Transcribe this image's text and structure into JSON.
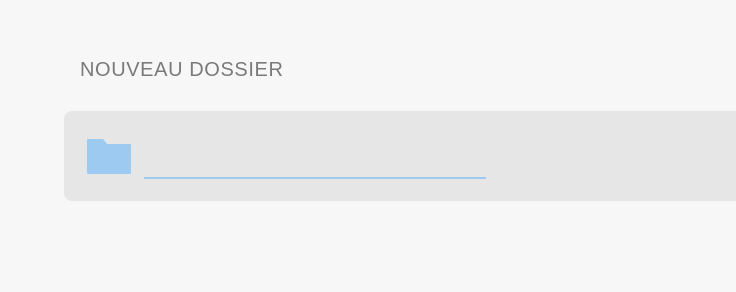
{
  "dialog": {
    "title": "NOUVEAU DOSSIER",
    "folder_icon": "folder-icon",
    "name_input": {
      "value": "",
      "placeholder": ""
    }
  },
  "colors": {
    "background": "#f7f7f7",
    "field_background": "#e6e6e6",
    "title_text": "#7a7a7a",
    "folder_icon": "#9ccaf0",
    "input_underline": "#9fcaf0"
  }
}
